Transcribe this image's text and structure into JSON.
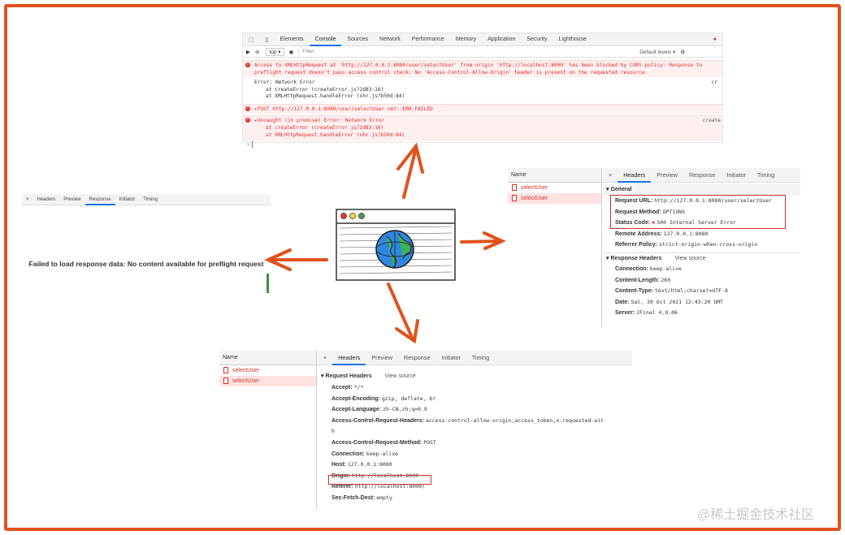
{
  "console": {
    "tabs": [
      "Elements",
      "Console",
      "Sources",
      "Network",
      "Performance",
      "Memory",
      "Application",
      "Security",
      "Lighthouse"
    ],
    "active_tab": "Console",
    "context": "top ▾",
    "filter_placeholder": "Filter",
    "levels": "Default levels ▾",
    "cors_error_line1": "Access to XMLHttpRequest at 'http://127.0.0.1:8080/user/selectUser' from origin 'http://localhost:8000' has been blocked by CORS policy: Response to",
    "cors_error_line2": "preflight request doesn't pass access control check: No 'Access-Control-Allow-Origin' header is present on the requested resource.",
    "net_error_1": "Error: Network Error",
    "net_error_1_side": "cr",
    "stack_1": "at createError (createError.js?2d83:16)",
    "stack_2": "at XMLHttpRequest.handleError (xhr.js?b50d:84)",
    "post_failed": "▸POST http://127.0.0.1:8080/user/selectUser net::ERR_FAILED",
    "uncaught": "▸Uncaught (in promise) Error: Network Error",
    "uncaught_side": "create",
    "stack_3": "at createError (createError.js?2d83:16)",
    "stack_4": "at XMLHttpRequest.handleError (xhr.js?b50d:84)",
    "prompt": "›"
  },
  "left_panel": {
    "tabs": [
      "Headers",
      "Preview",
      "Response",
      "Initiator",
      "Timing"
    ],
    "active_tab": "Response",
    "message": "Failed to load response data: No content available for preflight request"
  },
  "right_panel": {
    "name_header": "Name",
    "items": [
      "selectUser",
      "selectUser"
    ],
    "tabs": [
      "Headers",
      "Preview",
      "Response",
      "Initiator",
      "Timing"
    ],
    "active_tab": "Headers",
    "general_title": "▾ General",
    "request_url_k": "Request URL:",
    "request_url_v": "http://127.0.0.1:8080/user/selectUser",
    "request_method_k": "Request Method:",
    "request_method_v": "OPTIONS",
    "status_code_k": "Status Code:",
    "status_code_v": "500 Internal Server Error",
    "remote_k": "Remote Address:",
    "remote_v": "127.0.0.1:8080",
    "referrer_k": "Referrer Policy:",
    "referrer_v": "strict-origin-when-cross-origin",
    "resp_headers_title": "▾ Response Headers",
    "view_source": "View source",
    "conn_k": "Connection:",
    "conn_v": "keep-alive",
    "len_k": "Content-Length:",
    "len_v": "260",
    "type_k": "Content-Type:",
    "type_v": "text/html;charset=UTF-8",
    "date_k": "Date:",
    "date_v": "Sat, 30 Oct 2021 12:43:20 GMT",
    "server_k": "Server:",
    "server_v": "JFinal 4.9.06"
  },
  "bottom_panel": {
    "name_header": "Name",
    "items": [
      "selectUser",
      "selectUser"
    ],
    "tabs": [
      "Headers",
      "Preview",
      "Response",
      "Initiator",
      "Timing"
    ],
    "active_tab": "Headers",
    "req_headers_title": "▾ Request Headers",
    "view_source": "View source",
    "accept_k": "Accept:",
    "accept_v": "*/*",
    "enc_k": "Accept-Encoding:",
    "enc_v": "gzip, deflate, br",
    "lang_k": "Accept-Language:",
    "lang_v": "zh-CN,zh;q=0.9",
    "acrh_k": "Access-Control-Request-Headers:",
    "acrh_v": "access-control-allow-origin,access_token,x-requested-wit",
    "acrh_v2": "h",
    "acrm_k": "Access-Control-Request-Method:",
    "acrm_v": "POST",
    "conn_k": "Connection:",
    "conn_v": "keep-alive",
    "host_k": "Host:",
    "host_v": "127.0.0.1:8080",
    "origin_k": "Origin:",
    "origin_v": "http://localhost:8000",
    "referer_k": "Referer:",
    "referer_v": "http://localhost:8000/",
    "fetch_k": "Sec-Fetch-Dest:",
    "fetch_v": "empty"
  },
  "watermark": "@稀土掘金技术社区",
  "colors": {
    "accent": "#e0521b",
    "error": "#e02828",
    "highlight_box": "#d32f2f"
  }
}
